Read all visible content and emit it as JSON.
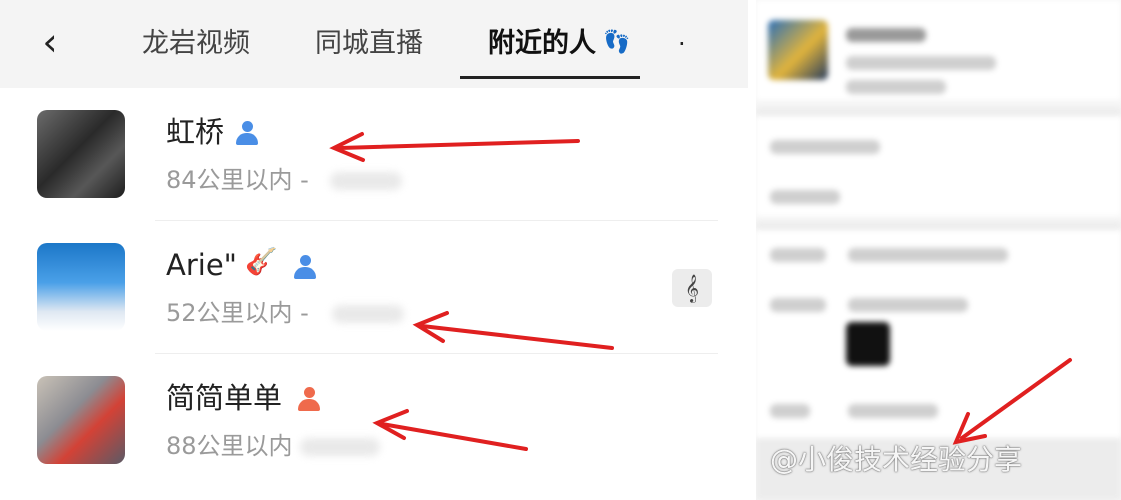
{
  "tabs": [
    {
      "label": "龙岩视频",
      "active": false
    },
    {
      "label": "同城直播",
      "active": false
    },
    {
      "label": "附近的人",
      "active": true
    }
  ],
  "tab_more": "·",
  "icons": {
    "back": "back-chevron-icon",
    "footprint": "footprint-icon",
    "guitar": "guitar-icon",
    "note": "music-note-icon",
    "user": "user-icon"
  },
  "people": [
    {
      "name": "虹桥",
      "distance": "84公里以内 -",
      "gender_color": "#4a8ee6"
    },
    {
      "name": "Arie\"",
      "distance": "52公里以内 -",
      "gender_color": "#4a8ee6"
    },
    {
      "name": "简简单单",
      "distance": "88公里以内",
      "gender_color": "#ef6a4c"
    }
  ],
  "watermark": "@小俊技术经验分享",
  "colors": {
    "arrow": "#e02020",
    "active_tab_underline": "#222222",
    "distance_text": "#9a9a9a"
  }
}
